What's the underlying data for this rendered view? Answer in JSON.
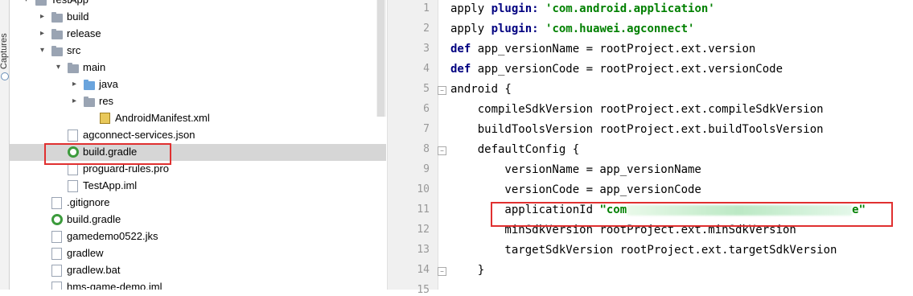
{
  "side_strip": {
    "label": "Captures"
  },
  "tree": {
    "items": [
      {
        "label": "TestApp",
        "indent": 0,
        "arrow": "▾",
        "icon": "folder"
      },
      {
        "label": "build",
        "indent": 1,
        "arrow": "▸",
        "icon": "folder"
      },
      {
        "label": "release",
        "indent": 1,
        "arrow": "▸",
        "icon": "folder"
      },
      {
        "label": "src",
        "indent": 1,
        "arrow": "▾",
        "icon": "folder"
      },
      {
        "label": "main",
        "indent": 2,
        "arrow": "▾",
        "icon": "folder"
      },
      {
        "label": "java",
        "indent": 3,
        "arrow": "▸",
        "icon": "folder-blue"
      },
      {
        "label": "res",
        "indent": 3,
        "arrow": "▸",
        "icon": "folder"
      },
      {
        "label": "AndroidManifest.xml",
        "indent": 4,
        "arrow": "",
        "icon": "xml"
      },
      {
        "label": "agconnect-services.json",
        "indent": 2,
        "arrow": "",
        "icon": "file"
      },
      {
        "label": "build.gradle",
        "indent": 2,
        "arrow": "",
        "icon": "gradle",
        "selected": true
      },
      {
        "label": "proguard-rules.pro",
        "indent": 2,
        "arrow": "",
        "icon": "file"
      },
      {
        "label": "TestApp.iml",
        "indent": 2,
        "arrow": "",
        "icon": "file"
      },
      {
        "label": ".gitignore",
        "indent": 1,
        "arrow": "",
        "icon": "file"
      },
      {
        "label": "build.gradle",
        "indent": 1,
        "arrow": "",
        "icon": "gradle"
      },
      {
        "label": "gamedemo0522.jks",
        "indent": 1,
        "arrow": "",
        "icon": "file"
      },
      {
        "label": "gradlew",
        "indent": 1,
        "arrow": "",
        "icon": "file"
      },
      {
        "label": "gradlew.bat",
        "indent": 1,
        "arrow": "",
        "icon": "file"
      },
      {
        "label": "hms-game-demo.iml",
        "indent": 1,
        "arrow": "",
        "icon": "file"
      }
    ]
  },
  "editor": {
    "lines": [
      {
        "n": "1",
        "parts": [
          [
            "",
            "apply "
          ],
          [
            "kw",
            "plugin: "
          ],
          [
            "str",
            "'com.android.application'"
          ]
        ]
      },
      {
        "n": "2",
        "parts": [
          [
            "",
            "apply "
          ],
          [
            "kw",
            "plugin: "
          ],
          [
            "str",
            "'com.huawei.agconnect'"
          ]
        ]
      },
      {
        "n": "3",
        "parts": [
          [
            "kw",
            "def "
          ],
          [
            "",
            "app_versionName = rootProject.ext.version"
          ]
        ]
      },
      {
        "n": "4",
        "parts": [
          [
            "kw",
            "def "
          ],
          [
            "",
            "app_versionCode = rootProject.ext.versionCode"
          ]
        ]
      },
      {
        "n": "5",
        "parts": [
          [
            "",
            "android {"
          ]
        ],
        "fold": true
      },
      {
        "n": "6",
        "parts": [
          [
            "",
            "    compileSdkVersion rootProject.ext.compileSdkVersion"
          ]
        ]
      },
      {
        "n": "7",
        "parts": [
          [
            "",
            "    buildToolsVersion rootProject.ext.buildToolsVersion"
          ]
        ]
      },
      {
        "n": "8",
        "parts": [
          [
            "",
            "    defaultConfig {"
          ]
        ],
        "fold": true
      },
      {
        "n": "9",
        "parts": [
          [
            "",
            "        versionName = app_versionName"
          ]
        ]
      },
      {
        "n": "10",
        "parts": [
          [
            "",
            "        versionCode = app_versionCode"
          ]
        ]
      },
      {
        "n": "11",
        "parts": [
          [
            "",
            "        applicationId "
          ],
          [
            "str",
            "\"com"
          ],
          [
            "blur",
            ""
          ],
          [
            "str",
            "e\""
          ]
        ]
      },
      {
        "n": "12",
        "parts": [
          [
            "",
            "        minSdkVersion rootProject.ext.minSdkVersion"
          ]
        ]
      },
      {
        "n": "13",
        "parts": [
          [
            "",
            "        targetSdkVersion rootProject.ext.targetSdkVersion"
          ]
        ]
      },
      {
        "n": "14",
        "parts": [
          [
            "",
            "    }"
          ]
        ],
        "fold": true
      },
      {
        "n": "15",
        "parts": [
          [
            "",
            ""
          ]
        ]
      }
    ]
  },
  "colors": {
    "highlight_box": "#e03030",
    "selection": "#d6d6d6",
    "keyword": "#000080",
    "string": "#008000"
  }
}
